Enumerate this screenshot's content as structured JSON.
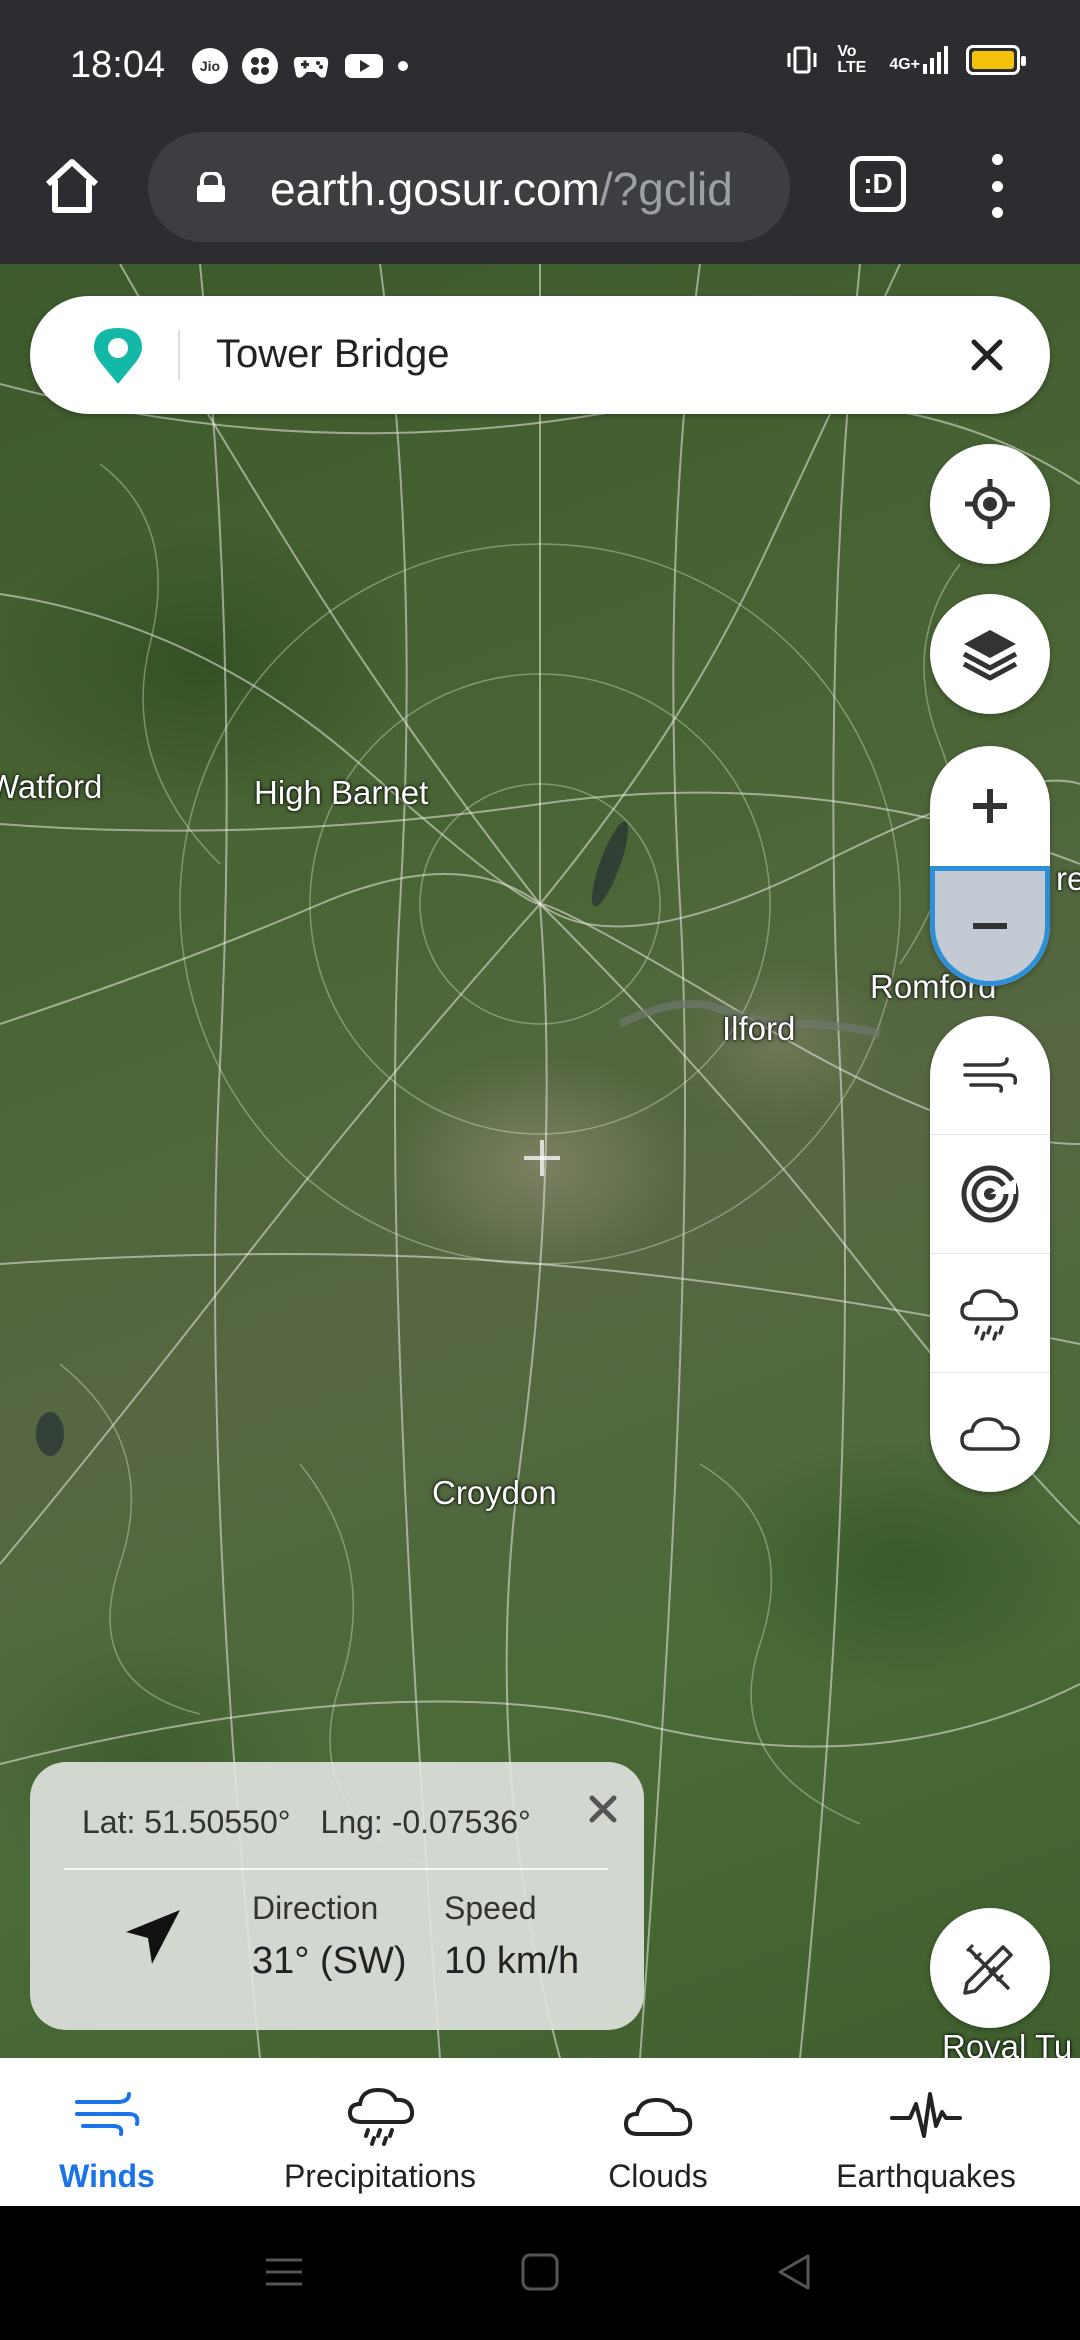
{
  "status_bar": {
    "time": "18:04",
    "left_icons": [
      "jio-icon",
      "game-controller-icon",
      "gamepad-icon",
      "youtube-icon",
      "notification-dot-icon"
    ],
    "right_icons": [
      "vibrate-icon",
      "volte-icon",
      "4g-signal-icon",
      "battery-icon"
    ],
    "network_label": "4G+",
    "volte_label": "Vo LTE"
  },
  "browser": {
    "url_domain": "earth.gosur.com",
    "url_path": "/?gclid",
    "tab_label": ":D"
  },
  "search": {
    "query": "Tower Bridge"
  },
  "map": {
    "places": [
      {
        "name": "Watford"
      },
      {
        "name": "High Barnet"
      },
      {
        "name": "Romford"
      },
      {
        "name": "Ilford"
      },
      {
        "name": "Croydon"
      },
      {
        "name": "Royal Tu"
      },
      {
        "name": "re"
      }
    ]
  },
  "controls": {
    "locate": "crosshair-target-icon",
    "layers": "layers-icon",
    "zoom_in": "plus-icon",
    "zoom_out": "minus-icon",
    "overlays": [
      "wind-icon",
      "radar-icon",
      "rain-cloud-icon",
      "cloud-icon"
    ],
    "draw": "pencil-ruler-icon"
  },
  "info_card": {
    "lat_label": "Lat: 51.50550°",
    "lng_label": "Lng: -0.07536°",
    "direction_label": "Direction",
    "direction_value": "31° (SW)",
    "speed_label": "Speed",
    "speed_value": "10 km/h"
  },
  "bottom_nav": {
    "items": [
      {
        "label": "Winds",
        "icon": "wind-icon",
        "active": true
      },
      {
        "label": "Precipitations",
        "icon": "rain-cloud-icon",
        "active": false
      },
      {
        "label": "Clouds",
        "icon": "cloud-icon",
        "active": false
      },
      {
        "label": "Earthquakes",
        "icon": "seismograph-icon",
        "active": false
      }
    ]
  },
  "colors": {
    "accent": "#1a73e8",
    "pin": "#14b8a6",
    "zoom_focus": "#2e8fd9",
    "bars": "#2b2d30"
  }
}
